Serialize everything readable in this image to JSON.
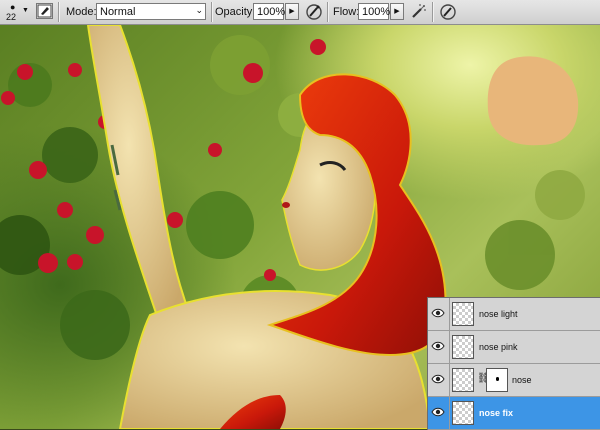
{
  "options_bar": {
    "brush_size": "22",
    "mode_label": "Mode:",
    "mode_value": "Normal",
    "opacity_label": "Opacity:",
    "opacity_value": "100%",
    "flow_label": "Flow:",
    "flow_value": "100%"
  },
  "layers": [
    {
      "name": "nose light",
      "visible": true,
      "selected": false,
      "has_mask": false
    },
    {
      "name": "nose pink",
      "visible": true,
      "selected": false,
      "has_mask": false
    },
    {
      "name": "nose",
      "visible": true,
      "selected": false,
      "has_mask": true
    },
    {
      "name": "nose fix",
      "visible": true,
      "selected": true,
      "has_mask": false
    }
  ],
  "colors": {
    "selection": "#3d95e6",
    "swatch": "#e8b67a",
    "hair": "#d4200a"
  }
}
